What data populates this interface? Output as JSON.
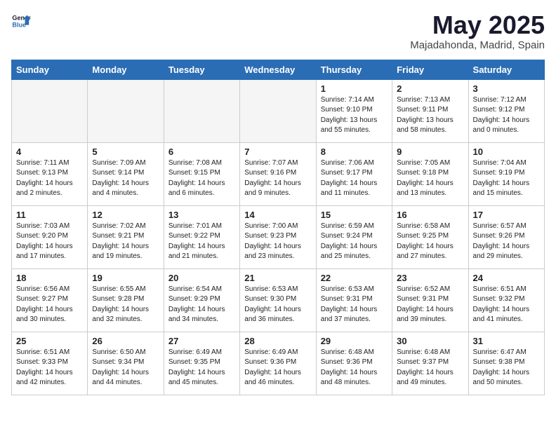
{
  "header": {
    "logo_line1": "General",
    "logo_line2": "Blue",
    "month_title": "May 2025",
    "subtitle": "Majadahonda, Madrid, Spain"
  },
  "weekdays": [
    "Sunday",
    "Monday",
    "Tuesday",
    "Wednesday",
    "Thursday",
    "Friday",
    "Saturday"
  ],
  "weeks": [
    [
      {
        "day": "",
        "info": "",
        "empty": true
      },
      {
        "day": "",
        "info": "",
        "empty": true
      },
      {
        "day": "",
        "info": "",
        "empty": true
      },
      {
        "day": "",
        "info": "",
        "empty": true
      },
      {
        "day": "1",
        "info": "Sunrise: 7:14 AM\nSunset: 9:10 PM\nDaylight: 13 hours\nand 55 minutes."
      },
      {
        "day": "2",
        "info": "Sunrise: 7:13 AM\nSunset: 9:11 PM\nDaylight: 13 hours\nand 58 minutes."
      },
      {
        "day": "3",
        "info": "Sunrise: 7:12 AM\nSunset: 9:12 PM\nDaylight: 14 hours\nand 0 minutes."
      }
    ],
    [
      {
        "day": "4",
        "info": "Sunrise: 7:11 AM\nSunset: 9:13 PM\nDaylight: 14 hours\nand 2 minutes."
      },
      {
        "day": "5",
        "info": "Sunrise: 7:09 AM\nSunset: 9:14 PM\nDaylight: 14 hours\nand 4 minutes."
      },
      {
        "day": "6",
        "info": "Sunrise: 7:08 AM\nSunset: 9:15 PM\nDaylight: 14 hours\nand 6 minutes."
      },
      {
        "day": "7",
        "info": "Sunrise: 7:07 AM\nSunset: 9:16 PM\nDaylight: 14 hours\nand 9 minutes."
      },
      {
        "day": "8",
        "info": "Sunrise: 7:06 AM\nSunset: 9:17 PM\nDaylight: 14 hours\nand 11 minutes."
      },
      {
        "day": "9",
        "info": "Sunrise: 7:05 AM\nSunset: 9:18 PM\nDaylight: 14 hours\nand 13 minutes."
      },
      {
        "day": "10",
        "info": "Sunrise: 7:04 AM\nSunset: 9:19 PM\nDaylight: 14 hours\nand 15 minutes."
      }
    ],
    [
      {
        "day": "11",
        "info": "Sunrise: 7:03 AM\nSunset: 9:20 PM\nDaylight: 14 hours\nand 17 minutes."
      },
      {
        "day": "12",
        "info": "Sunrise: 7:02 AM\nSunset: 9:21 PM\nDaylight: 14 hours\nand 19 minutes."
      },
      {
        "day": "13",
        "info": "Sunrise: 7:01 AM\nSunset: 9:22 PM\nDaylight: 14 hours\nand 21 minutes."
      },
      {
        "day": "14",
        "info": "Sunrise: 7:00 AM\nSunset: 9:23 PM\nDaylight: 14 hours\nand 23 minutes."
      },
      {
        "day": "15",
        "info": "Sunrise: 6:59 AM\nSunset: 9:24 PM\nDaylight: 14 hours\nand 25 minutes."
      },
      {
        "day": "16",
        "info": "Sunrise: 6:58 AM\nSunset: 9:25 PM\nDaylight: 14 hours\nand 27 minutes."
      },
      {
        "day": "17",
        "info": "Sunrise: 6:57 AM\nSunset: 9:26 PM\nDaylight: 14 hours\nand 29 minutes."
      }
    ],
    [
      {
        "day": "18",
        "info": "Sunrise: 6:56 AM\nSunset: 9:27 PM\nDaylight: 14 hours\nand 30 minutes."
      },
      {
        "day": "19",
        "info": "Sunrise: 6:55 AM\nSunset: 9:28 PM\nDaylight: 14 hours\nand 32 minutes."
      },
      {
        "day": "20",
        "info": "Sunrise: 6:54 AM\nSunset: 9:29 PM\nDaylight: 14 hours\nand 34 minutes."
      },
      {
        "day": "21",
        "info": "Sunrise: 6:53 AM\nSunset: 9:30 PM\nDaylight: 14 hours\nand 36 minutes."
      },
      {
        "day": "22",
        "info": "Sunrise: 6:53 AM\nSunset: 9:31 PM\nDaylight: 14 hours\nand 37 minutes."
      },
      {
        "day": "23",
        "info": "Sunrise: 6:52 AM\nSunset: 9:31 PM\nDaylight: 14 hours\nand 39 minutes."
      },
      {
        "day": "24",
        "info": "Sunrise: 6:51 AM\nSunset: 9:32 PM\nDaylight: 14 hours\nand 41 minutes."
      }
    ],
    [
      {
        "day": "25",
        "info": "Sunrise: 6:51 AM\nSunset: 9:33 PM\nDaylight: 14 hours\nand 42 minutes."
      },
      {
        "day": "26",
        "info": "Sunrise: 6:50 AM\nSunset: 9:34 PM\nDaylight: 14 hours\nand 44 minutes."
      },
      {
        "day": "27",
        "info": "Sunrise: 6:49 AM\nSunset: 9:35 PM\nDaylight: 14 hours\nand 45 minutes."
      },
      {
        "day": "28",
        "info": "Sunrise: 6:49 AM\nSunset: 9:36 PM\nDaylight: 14 hours\nand 46 minutes."
      },
      {
        "day": "29",
        "info": "Sunrise: 6:48 AM\nSunset: 9:36 PM\nDaylight: 14 hours\nand 48 minutes."
      },
      {
        "day": "30",
        "info": "Sunrise: 6:48 AM\nSunset: 9:37 PM\nDaylight: 14 hours\nand 49 minutes."
      },
      {
        "day": "31",
        "info": "Sunrise: 6:47 AM\nSunset: 9:38 PM\nDaylight: 14 hours\nand 50 minutes."
      }
    ]
  ]
}
